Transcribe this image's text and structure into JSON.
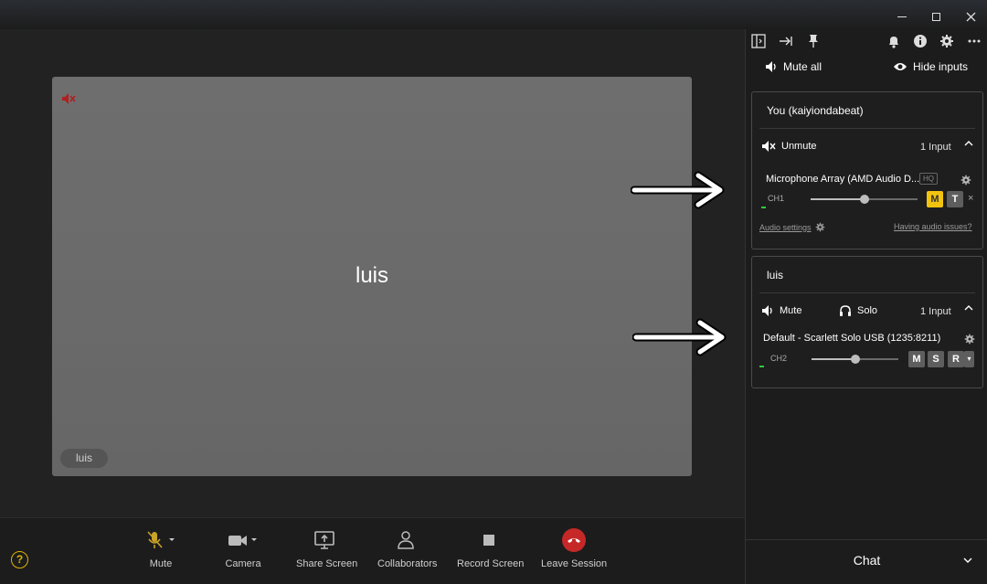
{
  "window": {
    "minimize": "—",
    "maximize": "□",
    "close": "✕"
  },
  "stage": {
    "participant_name": "luis",
    "name_pill": "luis"
  },
  "toolbar": {
    "help": "?",
    "items": [
      {
        "label": "Mute",
        "icon": "mic-off-icon"
      },
      {
        "label": "Camera",
        "icon": "camera-icon"
      },
      {
        "label": "Share Screen",
        "icon": "share-screen-icon"
      },
      {
        "label": "Collaborators",
        "icon": "collaborators-icon"
      },
      {
        "label": "Record Screen",
        "icon": "record-icon"
      },
      {
        "label": "Leave Session",
        "icon": "leave-call-icon"
      }
    ]
  },
  "side": {
    "mute_all": "Mute all",
    "hide_inputs": "Hide inputs",
    "you": {
      "title": "You (kaiyiondabeat)",
      "action": "Unmute",
      "inputs": "1 Input",
      "device": "Microphone Array (AMD Audio D...",
      "hq": "HQ",
      "channel": "CH1",
      "level": 0.5,
      "m": "M",
      "t": "T",
      "remove": "×",
      "audio_settings": "Audio settings",
      "issues": "Having audio issues?"
    },
    "luis": {
      "title": "luis",
      "action": "Mute",
      "solo": "Solo",
      "inputs": "1 Input",
      "device": "Default - Scarlett Solo USB (1235:8211)",
      "channel": "CH2",
      "level": 0.5,
      "m": "M",
      "s": "S",
      "r": "R",
      "more": "▾"
    },
    "chat": "Chat"
  },
  "colors": {
    "accent_yellow": "#f2c40f",
    "leave_red": "#c62828",
    "muted_red": "#b02020"
  }
}
